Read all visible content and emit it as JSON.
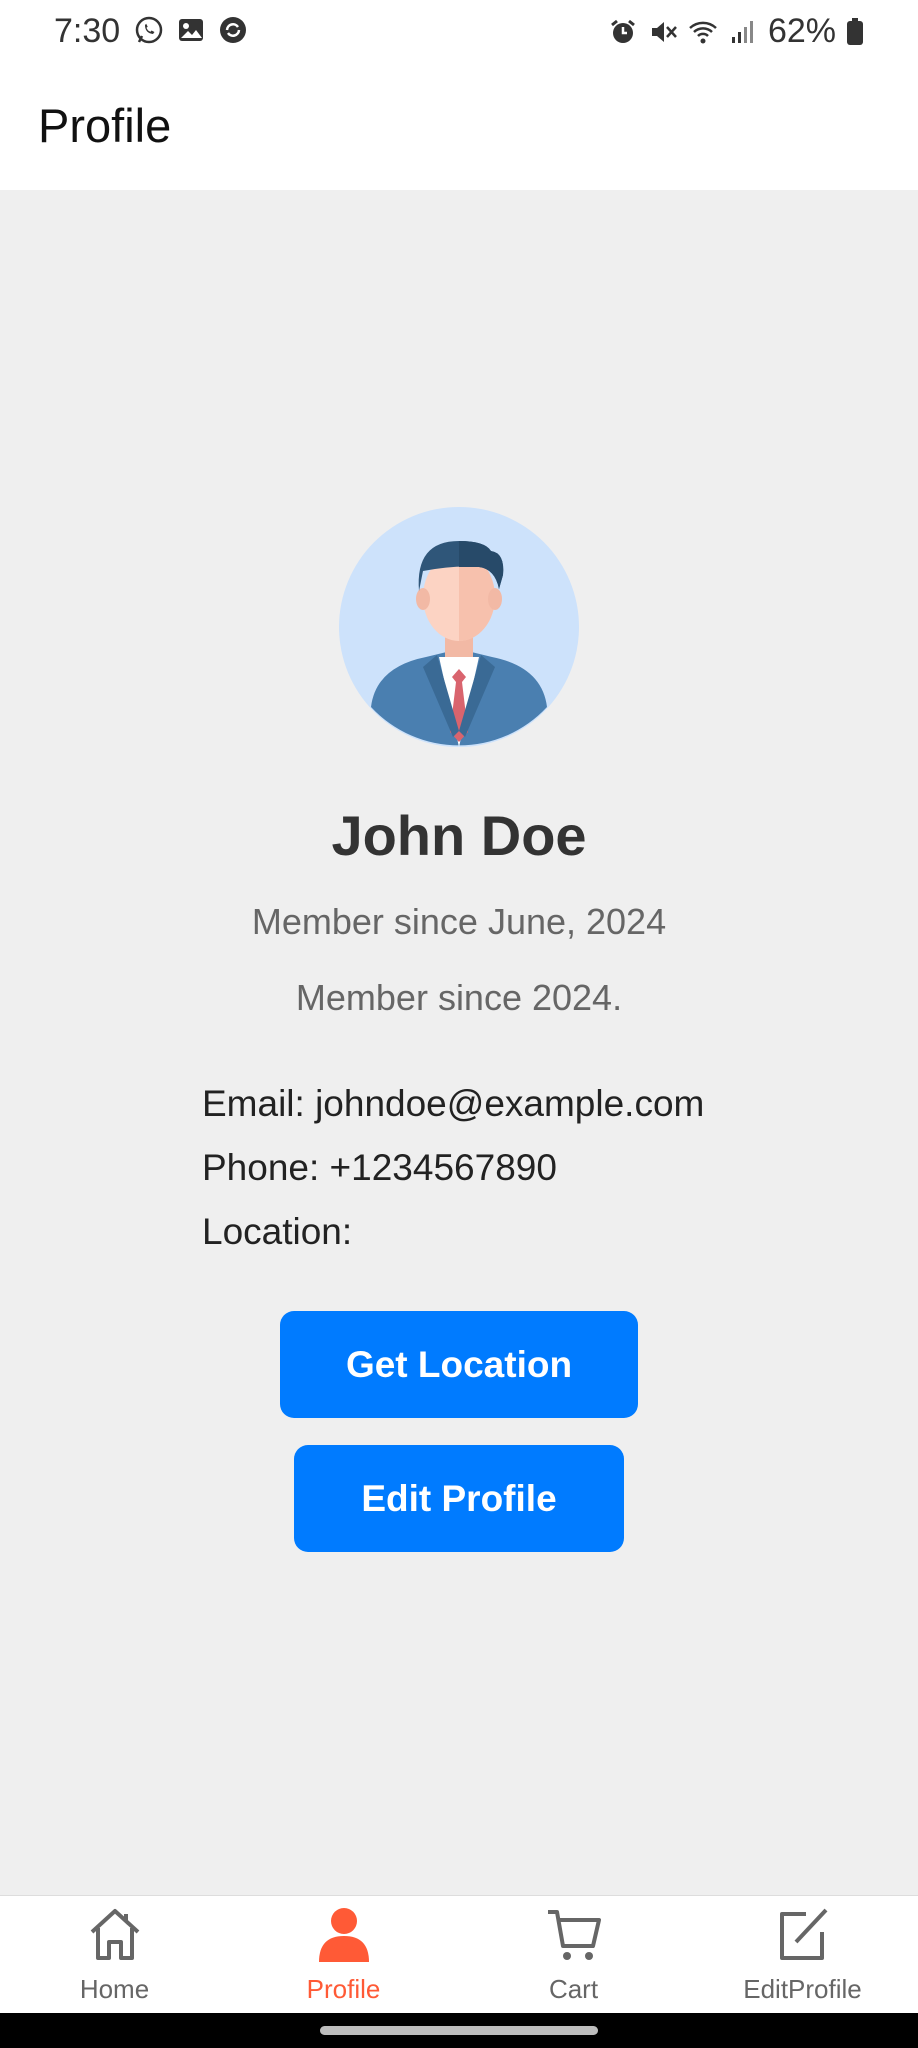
{
  "status_bar": {
    "time": "7:30",
    "left_icons": [
      "whatsapp-icon",
      "gallery-icon",
      "sync-app-icon"
    ],
    "right_icons": [
      "alarm-icon",
      "mute-icon",
      "wifi-icon",
      "signal-icon"
    ],
    "battery_percent": "62%"
  },
  "header": {
    "title": "Profile"
  },
  "profile": {
    "avatar_icon": "businessman-avatar-icon",
    "name": "John Doe",
    "member_since_month": "Member since June, 2024",
    "member_since_year": "Member since 2024.",
    "email_line": "Email: johndoe@example.com",
    "phone_line": "Phone: +1234567890",
    "location_line": "Location:"
  },
  "buttons": {
    "get_location": "Get Location",
    "edit_profile": "Edit Profile"
  },
  "nav": {
    "items": [
      {
        "label": "Home",
        "icon": "home-icon",
        "active": false
      },
      {
        "label": "Profile",
        "icon": "person-icon",
        "active": true
      },
      {
        "label": "Cart",
        "icon": "cart-icon",
        "active": false
      },
      {
        "label": "EditProfile",
        "icon": "edit-icon",
        "active": false
      }
    ]
  },
  "colors": {
    "accent_blue": "#007bff",
    "active_orange": "#ff5a36",
    "background": "#efefef"
  }
}
